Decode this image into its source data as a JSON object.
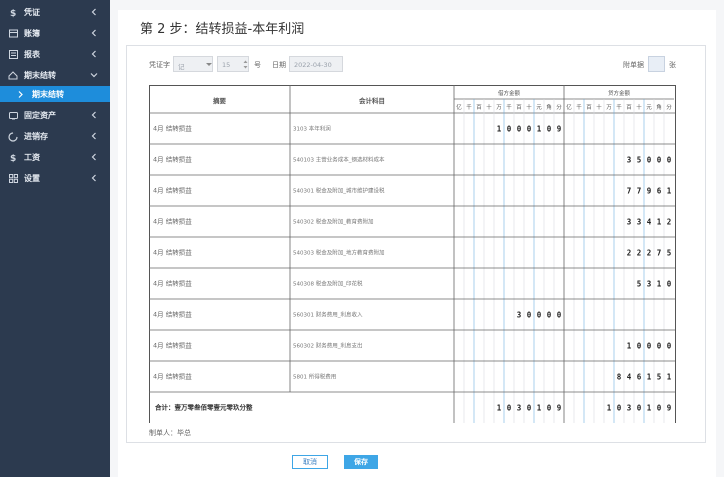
{
  "sidebar": {
    "items": [
      {
        "label": "凭证",
        "icon": "dollar-icon"
      },
      {
        "label": "账簿",
        "icon": "book-icon"
      },
      {
        "label": "报表",
        "icon": "report-icon"
      },
      {
        "label": "期末结转",
        "icon": "closing-icon"
      },
      {
        "label": "固定资产",
        "icon": "asset-icon"
      },
      {
        "label": "进销存",
        "icon": "inventory-icon"
      },
      {
        "label": "工资",
        "icon": "salary-icon"
      },
      {
        "label": "设置",
        "icon": "settings-icon"
      }
    ],
    "active_sub": "期末结转"
  },
  "page": {
    "title": "第 2 步：结转损益-本年利润"
  },
  "voucher": {
    "word_label": "凭证字",
    "word_value": "记",
    "number_value": "15",
    "number_unit": "号",
    "date_label": "日期",
    "date_value": "2022-04-30",
    "attach_label": "附单据",
    "attach_value": "",
    "attach_unit": "张",
    "headers": {
      "summary": "摘要",
      "account": "会计科目",
      "debit": "借方金额",
      "credit": "贷方金额"
    },
    "digit_units": [
      "亿",
      "千",
      "百",
      "十",
      "万",
      "千",
      "百",
      "十",
      "元",
      "角",
      "分"
    ],
    "rows": [
      {
        "summary": "4月 结转损益",
        "account": "3103 本年利润",
        "debit": "1000109",
        "credit": ""
      },
      {
        "summary": "4月 结转损益",
        "account": "540103 主营业务成本_钢选材料成本",
        "debit": "",
        "credit": "35000"
      },
      {
        "summary": "4月 结转损益",
        "account": "540301 税金及附加_城市维护建设税",
        "debit": "",
        "credit": "77961"
      },
      {
        "summary": "4月 结转损益",
        "account": "540302 税金及附加_教育费附加",
        "debit": "",
        "credit": "33412"
      },
      {
        "summary": "4月 结转损益",
        "account": "540303 税金及附加_地方教育费附加",
        "debit": "",
        "credit": "22275"
      },
      {
        "summary": "4月 结转损益",
        "account": "540308 税金及附加_印花税",
        "debit": "",
        "credit": "5310"
      },
      {
        "summary": "4月 结转损益",
        "account": "560301 财务费用_利息收入",
        "debit": "30000",
        "credit": ""
      },
      {
        "summary": "4月 结转损益",
        "account": "560302 财务费用_利息支出",
        "debit": "",
        "credit": "10000"
      },
      {
        "summary": "4月 结转损益",
        "account": "5801 所得税费用",
        "debit": "",
        "credit": "846151"
      }
    ],
    "total": {
      "label": "合计：壹万零叁佰零壹元零玖分整",
      "debit": "1030109",
      "credit": "1030109"
    },
    "maker_label": "制单人：",
    "maker_value": "毕总"
  },
  "actions": {
    "cancel_label": "取消",
    "save_label": "保存"
  },
  "colors": {
    "sidebar_bg": "#2c3a4f",
    "active_sub_bg": "#1e8ddb",
    "save_button": "#3ea6e6",
    "cancel_border": "#3ea6e6"
  }
}
